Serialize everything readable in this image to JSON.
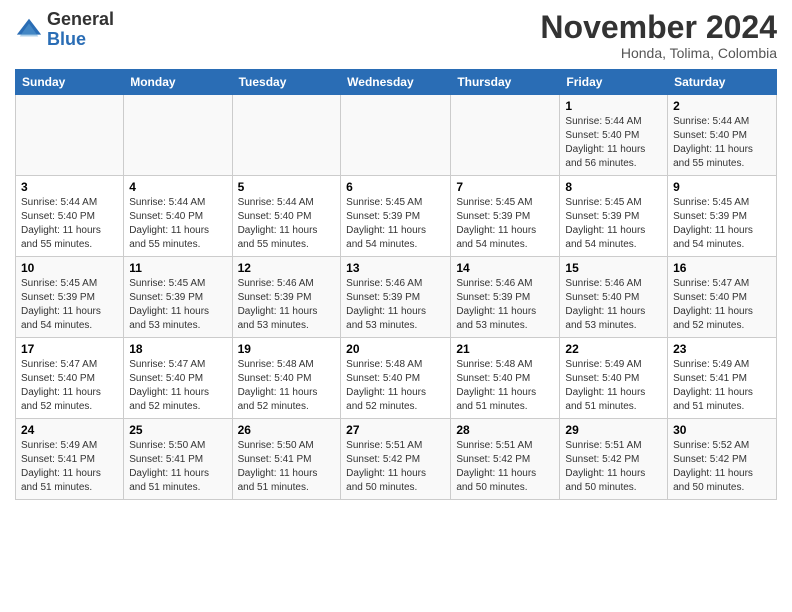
{
  "header": {
    "logo_general": "General",
    "logo_blue": "Blue",
    "month_title": "November 2024",
    "location": "Honda, Tolima, Colombia"
  },
  "weekdays": [
    "Sunday",
    "Monday",
    "Tuesday",
    "Wednesday",
    "Thursday",
    "Friday",
    "Saturday"
  ],
  "weeks": [
    [
      {
        "day": "",
        "info": ""
      },
      {
        "day": "",
        "info": ""
      },
      {
        "day": "",
        "info": ""
      },
      {
        "day": "",
        "info": ""
      },
      {
        "day": "",
        "info": ""
      },
      {
        "day": "1",
        "info": "Sunrise: 5:44 AM\nSunset: 5:40 PM\nDaylight: 11 hours\nand 56 minutes."
      },
      {
        "day": "2",
        "info": "Sunrise: 5:44 AM\nSunset: 5:40 PM\nDaylight: 11 hours\nand 55 minutes."
      }
    ],
    [
      {
        "day": "3",
        "info": "Sunrise: 5:44 AM\nSunset: 5:40 PM\nDaylight: 11 hours\nand 55 minutes."
      },
      {
        "day": "4",
        "info": "Sunrise: 5:44 AM\nSunset: 5:40 PM\nDaylight: 11 hours\nand 55 minutes."
      },
      {
        "day": "5",
        "info": "Sunrise: 5:44 AM\nSunset: 5:40 PM\nDaylight: 11 hours\nand 55 minutes."
      },
      {
        "day": "6",
        "info": "Sunrise: 5:45 AM\nSunset: 5:39 PM\nDaylight: 11 hours\nand 54 minutes."
      },
      {
        "day": "7",
        "info": "Sunrise: 5:45 AM\nSunset: 5:39 PM\nDaylight: 11 hours\nand 54 minutes."
      },
      {
        "day": "8",
        "info": "Sunrise: 5:45 AM\nSunset: 5:39 PM\nDaylight: 11 hours\nand 54 minutes."
      },
      {
        "day": "9",
        "info": "Sunrise: 5:45 AM\nSunset: 5:39 PM\nDaylight: 11 hours\nand 54 minutes."
      }
    ],
    [
      {
        "day": "10",
        "info": "Sunrise: 5:45 AM\nSunset: 5:39 PM\nDaylight: 11 hours\nand 54 minutes."
      },
      {
        "day": "11",
        "info": "Sunrise: 5:45 AM\nSunset: 5:39 PM\nDaylight: 11 hours\nand 53 minutes."
      },
      {
        "day": "12",
        "info": "Sunrise: 5:46 AM\nSunset: 5:39 PM\nDaylight: 11 hours\nand 53 minutes."
      },
      {
        "day": "13",
        "info": "Sunrise: 5:46 AM\nSunset: 5:39 PM\nDaylight: 11 hours\nand 53 minutes."
      },
      {
        "day": "14",
        "info": "Sunrise: 5:46 AM\nSunset: 5:39 PM\nDaylight: 11 hours\nand 53 minutes."
      },
      {
        "day": "15",
        "info": "Sunrise: 5:46 AM\nSunset: 5:40 PM\nDaylight: 11 hours\nand 53 minutes."
      },
      {
        "day": "16",
        "info": "Sunrise: 5:47 AM\nSunset: 5:40 PM\nDaylight: 11 hours\nand 52 minutes."
      }
    ],
    [
      {
        "day": "17",
        "info": "Sunrise: 5:47 AM\nSunset: 5:40 PM\nDaylight: 11 hours\nand 52 minutes."
      },
      {
        "day": "18",
        "info": "Sunrise: 5:47 AM\nSunset: 5:40 PM\nDaylight: 11 hours\nand 52 minutes."
      },
      {
        "day": "19",
        "info": "Sunrise: 5:48 AM\nSunset: 5:40 PM\nDaylight: 11 hours\nand 52 minutes."
      },
      {
        "day": "20",
        "info": "Sunrise: 5:48 AM\nSunset: 5:40 PM\nDaylight: 11 hours\nand 52 minutes."
      },
      {
        "day": "21",
        "info": "Sunrise: 5:48 AM\nSunset: 5:40 PM\nDaylight: 11 hours\nand 51 minutes."
      },
      {
        "day": "22",
        "info": "Sunrise: 5:49 AM\nSunset: 5:40 PM\nDaylight: 11 hours\nand 51 minutes."
      },
      {
        "day": "23",
        "info": "Sunrise: 5:49 AM\nSunset: 5:41 PM\nDaylight: 11 hours\nand 51 minutes."
      }
    ],
    [
      {
        "day": "24",
        "info": "Sunrise: 5:49 AM\nSunset: 5:41 PM\nDaylight: 11 hours\nand 51 minutes."
      },
      {
        "day": "25",
        "info": "Sunrise: 5:50 AM\nSunset: 5:41 PM\nDaylight: 11 hours\nand 51 minutes."
      },
      {
        "day": "26",
        "info": "Sunrise: 5:50 AM\nSunset: 5:41 PM\nDaylight: 11 hours\nand 51 minutes."
      },
      {
        "day": "27",
        "info": "Sunrise: 5:51 AM\nSunset: 5:42 PM\nDaylight: 11 hours\nand 50 minutes."
      },
      {
        "day": "28",
        "info": "Sunrise: 5:51 AM\nSunset: 5:42 PM\nDaylight: 11 hours\nand 50 minutes."
      },
      {
        "day": "29",
        "info": "Sunrise: 5:51 AM\nSunset: 5:42 PM\nDaylight: 11 hours\nand 50 minutes."
      },
      {
        "day": "30",
        "info": "Sunrise: 5:52 AM\nSunset: 5:42 PM\nDaylight: 11 hours\nand 50 minutes."
      }
    ]
  ]
}
